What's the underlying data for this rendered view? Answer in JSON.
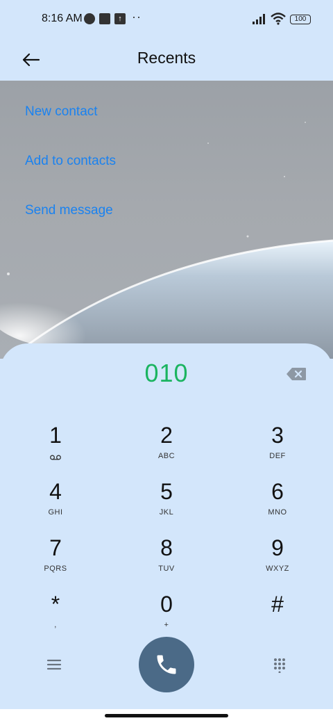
{
  "status_bar": {
    "time": "8:16 AM",
    "battery": "100",
    "extra": "··"
  },
  "header": {
    "title": "Recents",
    "back_icon": "arrow-left-icon"
  },
  "actions": [
    {
      "label": "New contact"
    },
    {
      "label": "Add to contacts"
    },
    {
      "label": "Send message"
    }
  ],
  "dialer": {
    "number": "010",
    "number_color": "#1bb460",
    "keys": [
      {
        "digit": "1",
        "letters": ""
      },
      {
        "digit": "2",
        "letters": "ABC"
      },
      {
        "digit": "3",
        "letters": "DEF"
      },
      {
        "digit": "4",
        "letters": "GHI"
      },
      {
        "digit": "5",
        "letters": "JKL"
      },
      {
        "digit": "6",
        "letters": "MNO"
      },
      {
        "digit": "7",
        "letters": "PQRS"
      },
      {
        "digit": "8",
        "letters": "TUV"
      },
      {
        "digit": "9",
        "letters": "WXYZ"
      },
      {
        "digit": "*",
        "letters": ","
      },
      {
        "digit": "0",
        "letters": "+"
      },
      {
        "digit": "#",
        "letters": ""
      }
    ]
  },
  "colors": {
    "background": "#d3e6fb",
    "link": "#1a82f0",
    "call_button": "#4b6a87"
  }
}
